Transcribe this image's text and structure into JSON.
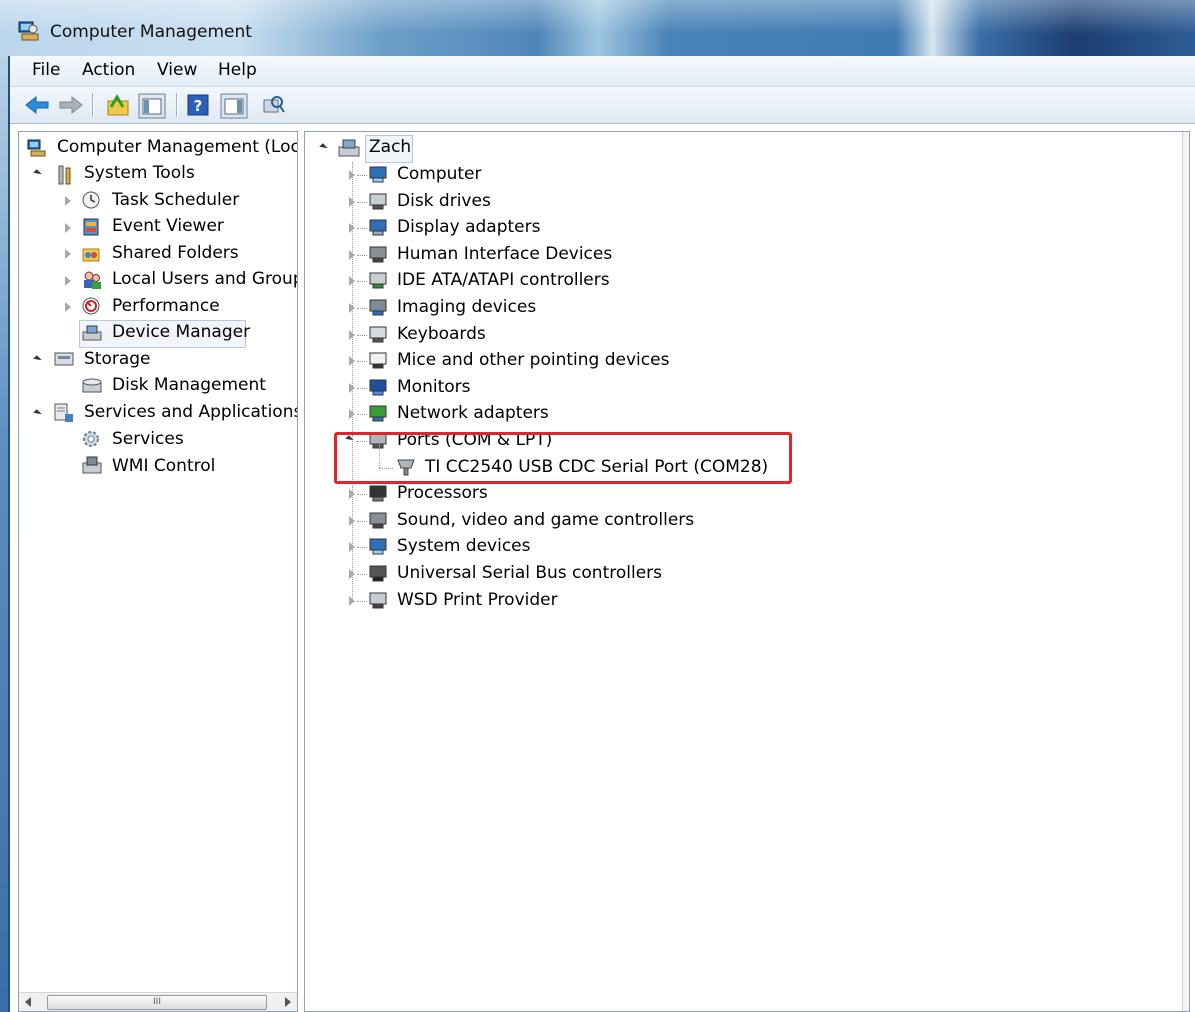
{
  "window": {
    "title": "Computer Management"
  },
  "menu": [
    "File",
    "Action",
    "View",
    "Help"
  ],
  "left_tree": [
    {
      "label": "Computer Management (Local",
      "icon": "computer-management-icon"
    },
    {
      "label": "System Tools",
      "icon": "tools-icon"
    },
    {
      "label": "Task Scheduler",
      "icon": "clock-icon"
    },
    {
      "label": "Event Viewer",
      "icon": "event-viewer-icon"
    },
    {
      "label": "Shared Folders",
      "icon": "shared-folder-icon"
    },
    {
      "label": "Local Users and Groups",
      "icon": "users-icon"
    },
    {
      "label": "Performance",
      "icon": "performance-icon"
    },
    {
      "label": "Device Manager",
      "icon": "device-manager-icon"
    },
    {
      "label": "Storage",
      "icon": "storage-icon"
    },
    {
      "label": "Disk Management",
      "icon": "disk-icon"
    },
    {
      "label": "Services and Applications",
      "icon": "services-apps-icon"
    },
    {
      "label": "Services",
      "icon": "gear-icon"
    },
    {
      "label": "WMI Control",
      "icon": "wmi-icon"
    }
  ],
  "device_tree": {
    "root": "Zach",
    "categories": [
      {
        "label": "Computer",
        "icon": "computer-icon"
      },
      {
        "label": "Disk drives",
        "icon": "disk-drive-icon"
      },
      {
        "label": "Display adapters",
        "icon": "display-adapter-icon"
      },
      {
        "label": "Human Interface Devices",
        "icon": "hid-icon"
      },
      {
        "label": "IDE ATA/ATAPI controllers",
        "icon": "ide-controller-icon"
      },
      {
        "label": "Imaging devices",
        "icon": "camera-icon"
      },
      {
        "label": "Keyboards",
        "icon": "keyboard-icon"
      },
      {
        "label": "Mice and other pointing devices",
        "icon": "mouse-icon"
      },
      {
        "label": "Monitors",
        "icon": "monitor-icon"
      },
      {
        "label": "Network adapters",
        "icon": "network-icon"
      },
      {
        "label": "Ports (COM & LPT)",
        "icon": "port-icon"
      },
      {
        "label": "Processors",
        "icon": "cpu-icon"
      },
      {
        "label": "Sound, video and game controllers",
        "icon": "speaker-icon"
      },
      {
        "label": "System devices",
        "icon": "system-icon"
      },
      {
        "label": "Universal Serial Bus controllers",
        "icon": "usb-icon"
      },
      {
        "label": "WSD Print Provider",
        "icon": "printer-icon"
      }
    ],
    "ports_child": {
      "label": "TI CC2540 USB CDC Serial Port (COM28)",
      "icon": "serial-port-icon"
    }
  },
  "scrollbar": {
    "thumb_glyph": "III"
  },
  "colors": {
    "highlight": "#e0262c",
    "title_bar": "#4f86ba"
  }
}
